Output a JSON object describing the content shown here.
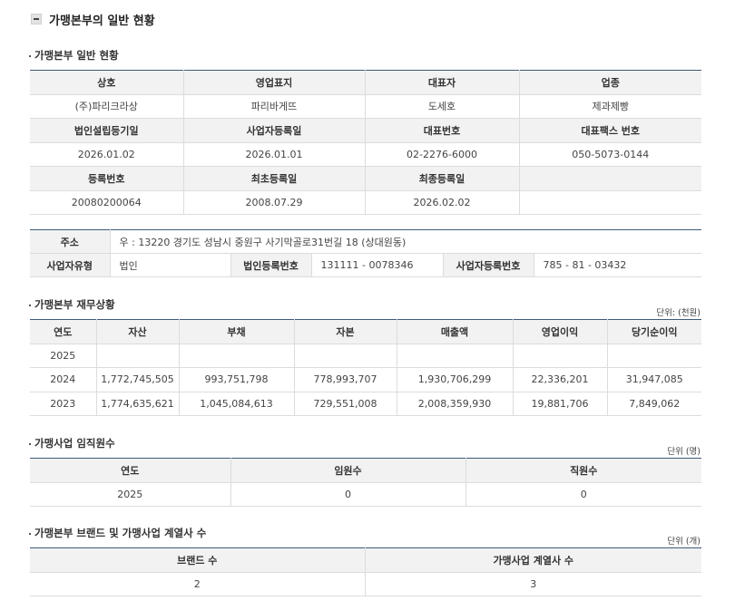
{
  "page_title": "가맹본부의 일반 현황",
  "general": {
    "title": "가맹본부 일반 현황",
    "row1_headers": [
      "상호",
      "영업표지",
      "대표자",
      "업종"
    ],
    "row1_values": [
      "(주)파리크라상",
      "파리바게뜨",
      "도세호",
      "제과제빵"
    ],
    "row2_headers": [
      "법인설립등기일",
      "사업자등록일",
      "대표번호",
      "대표팩스 번호"
    ],
    "row2_values": [
      "2026.01.02",
      "2026.01.01",
      "02-2276-6000",
      "050-5073-0144"
    ],
    "row3_headers": [
      "등록번호",
      "최초등록일",
      "최종등록일",
      ""
    ],
    "row3_values": [
      "20080200064",
      "2008.07.29",
      "2026.02.02",
      ""
    ]
  },
  "address": {
    "address_label": "주소",
    "address_value": "우 : 13220 경기도 성남시 중원구 사기막골로31번길 18 (상대원동)",
    "biz_type_label": "사업자유형",
    "biz_type_value": "법인",
    "corp_no_label": "법인등록번호",
    "corp_no_value": "131111 - 0078346",
    "biz_no_label": "사업자등록번호",
    "biz_no_value": "785 - 81 - 03432"
  },
  "finance": {
    "title": "가맹본부 재무상황",
    "unit": "단위: (천원)",
    "headers": [
      "연도",
      "자산",
      "부채",
      "자본",
      "매출액",
      "영업이익",
      "당기순이익"
    ],
    "rows": [
      [
        "2025",
        "",
        "",
        "",
        "",
        "",
        ""
      ],
      [
        "2024",
        "1,772,745,505",
        "993,751,798",
        "778,993,707",
        "1,930,706,299",
        "22,336,201",
        "31,947,085"
      ],
      [
        "2023",
        "1,774,635,621",
        "1,045,084,613",
        "729,551,008",
        "2,008,359,930",
        "19,881,706",
        "7,849,062"
      ]
    ]
  },
  "staff": {
    "title": "가맹사업 임직원수",
    "unit": "단위 (명)",
    "headers": [
      "연도",
      "임원수",
      "직원수"
    ],
    "rows": [
      [
        "2025",
        "0",
        "0"
      ]
    ]
  },
  "brands": {
    "title": "가맹본부 브랜드 및 가맹사업 계열사 수",
    "unit": "단위 (개)",
    "headers": [
      "브랜드 수",
      "가맹사업 계열사 수"
    ],
    "rows": [
      [
        "2",
        "3"
      ]
    ]
  }
}
